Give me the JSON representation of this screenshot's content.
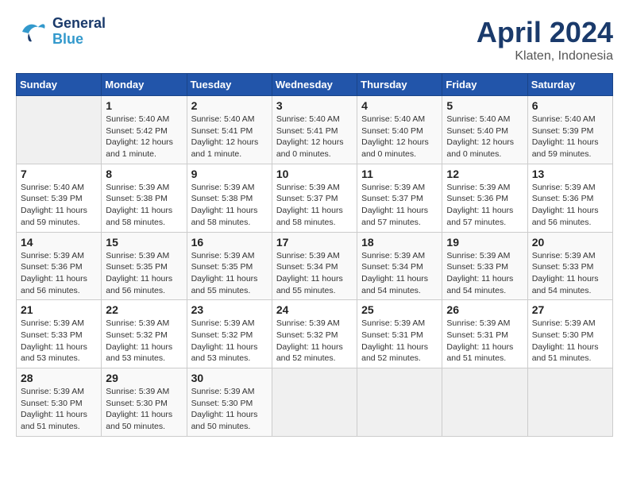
{
  "header": {
    "logo_general": "General",
    "logo_blue": "Blue",
    "month_title": "April 2024",
    "location": "Klaten, Indonesia"
  },
  "days_of_week": [
    "Sunday",
    "Monday",
    "Tuesday",
    "Wednesday",
    "Thursday",
    "Friday",
    "Saturday"
  ],
  "weeks": [
    [
      {
        "day": "",
        "info": ""
      },
      {
        "day": "1",
        "info": "Sunrise: 5:40 AM\nSunset: 5:42 PM\nDaylight: 12 hours\nand 1 minute."
      },
      {
        "day": "2",
        "info": "Sunrise: 5:40 AM\nSunset: 5:41 PM\nDaylight: 12 hours\nand 1 minute."
      },
      {
        "day": "3",
        "info": "Sunrise: 5:40 AM\nSunset: 5:41 PM\nDaylight: 12 hours\nand 0 minutes."
      },
      {
        "day": "4",
        "info": "Sunrise: 5:40 AM\nSunset: 5:40 PM\nDaylight: 12 hours\nand 0 minutes."
      },
      {
        "day": "5",
        "info": "Sunrise: 5:40 AM\nSunset: 5:40 PM\nDaylight: 12 hours\nand 0 minutes."
      },
      {
        "day": "6",
        "info": "Sunrise: 5:40 AM\nSunset: 5:39 PM\nDaylight: 11 hours\nand 59 minutes."
      }
    ],
    [
      {
        "day": "7",
        "info": "Sunrise: 5:40 AM\nSunset: 5:39 PM\nDaylight: 11 hours\nand 59 minutes."
      },
      {
        "day": "8",
        "info": "Sunrise: 5:39 AM\nSunset: 5:38 PM\nDaylight: 11 hours\nand 58 minutes."
      },
      {
        "day": "9",
        "info": "Sunrise: 5:39 AM\nSunset: 5:38 PM\nDaylight: 11 hours\nand 58 minutes."
      },
      {
        "day": "10",
        "info": "Sunrise: 5:39 AM\nSunset: 5:37 PM\nDaylight: 11 hours\nand 58 minutes."
      },
      {
        "day": "11",
        "info": "Sunrise: 5:39 AM\nSunset: 5:37 PM\nDaylight: 11 hours\nand 57 minutes."
      },
      {
        "day": "12",
        "info": "Sunrise: 5:39 AM\nSunset: 5:36 PM\nDaylight: 11 hours\nand 57 minutes."
      },
      {
        "day": "13",
        "info": "Sunrise: 5:39 AM\nSunset: 5:36 PM\nDaylight: 11 hours\nand 56 minutes."
      }
    ],
    [
      {
        "day": "14",
        "info": "Sunrise: 5:39 AM\nSunset: 5:36 PM\nDaylight: 11 hours\nand 56 minutes."
      },
      {
        "day": "15",
        "info": "Sunrise: 5:39 AM\nSunset: 5:35 PM\nDaylight: 11 hours\nand 56 minutes."
      },
      {
        "day": "16",
        "info": "Sunrise: 5:39 AM\nSunset: 5:35 PM\nDaylight: 11 hours\nand 55 minutes."
      },
      {
        "day": "17",
        "info": "Sunrise: 5:39 AM\nSunset: 5:34 PM\nDaylight: 11 hours\nand 55 minutes."
      },
      {
        "day": "18",
        "info": "Sunrise: 5:39 AM\nSunset: 5:34 PM\nDaylight: 11 hours\nand 54 minutes."
      },
      {
        "day": "19",
        "info": "Sunrise: 5:39 AM\nSunset: 5:33 PM\nDaylight: 11 hours\nand 54 minutes."
      },
      {
        "day": "20",
        "info": "Sunrise: 5:39 AM\nSunset: 5:33 PM\nDaylight: 11 hours\nand 54 minutes."
      }
    ],
    [
      {
        "day": "21",
        "info": "Sunrise: 5:39 AM\nSunset: 5:33 PM\nDaylight: 11 hours\nand 53 minutes."
      },
      {
        "day": "22",
        "info": "Sunrise: 5:39 AM\nSunset: 5:32 PM\nDaylight: 11 hours\nand 53 minutes."
      },
      {
        "day": "23",
        "info": "Sunrise: 5:39 AM\nSunset: 5:32 PM\nDaylight: 11 hours\nand 53 minutes."
      },
      {
        "day": "24",
        "info": "Sunrise: 5:39 AM\nSunset: 5:32 PM\nDaylight: 11 hours\nand 52 minutes."
      },
      {
        "day": "25",
        "info": "Sunrise: 5:39 AM\nSunset: 5:31 PM\nDaylight: 11 hours\nand 52 minutes."
      },
      {
        "day": "26",
        "info": "Sunrise: 5:39 AM\nSunset: 5:31 PM\nDaylight: 11 hours\nand 51 minutes."
      },
      {
        "day": "27",
        "info": "Sunrise: 5:39 AM\nSunset: 5:30 PM\nDaylight: 11 hours\nand 51 minutes."
      }
    ],
    [
      {
        "day": "28",
        "info": "Sunrise: 5:39 AM\nSunset: 5:30 PM\nDaylight: 11 hours\nand 51 minutes."
      },
      {
        "day": "29",
        "info": "Sunrise: 5:39 AM\nSunset: 5:30 PM\nDaylight: 11 hours\nand 50 minutes."
      },
      {
        "day": "30",
        "info": "Sunrise: 5:39 AM\nSunset: 5:30 PM\nDaylight: 11 hours\nand 50 minutes."
      },
      {
        "day": "",
        "info": ""
      },
      {
        "day": "",
        "info": ""
      },
      {
        "day": "",
        "info": ""
      },
      {
        "day": "",
        "info": ""
      }
    ]
  ]
}
